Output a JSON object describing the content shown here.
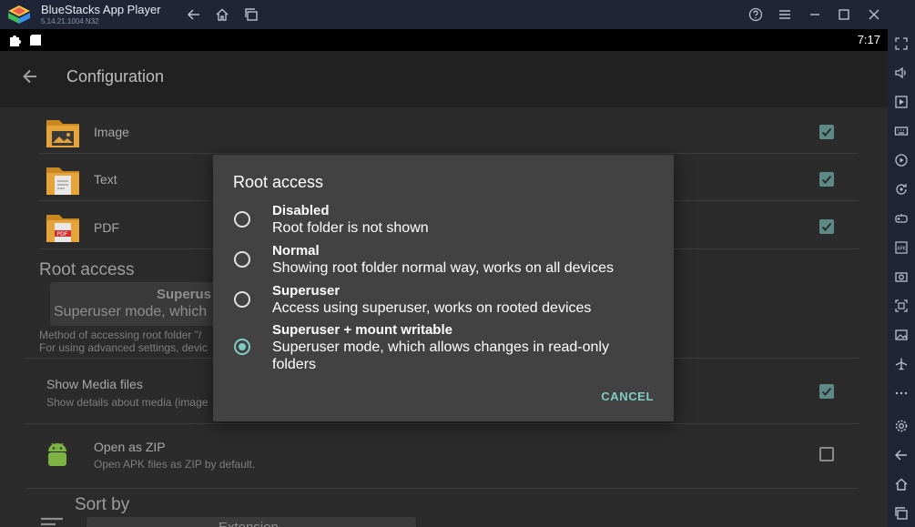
{
  "window": {
    "app_name": "BlueStacks App Player",
    "version": "5.14.21.1004  N32"
  },
  "statusbar": {
    "time": "7:17"
  },
  "appbar": {
    "title": "Configuration"
  },
  "file_types": [
    {
      "label": "Image",
      "checked": true
    },
    {
      "label": "Text",
      "checked": true
    },
    {
      "label": "PDF",
      "checked": true
    }
  ],
  "root_access_section": {
    "title": "Root access",
    "selected_title": "Superus",
    "selected_desc": "Superuser mode, which",
    "desc_line1": "Method of accessing root folder \"/",
    "desc_line2": "For using advanced settings, devic"
  },
  "show_media": {
    "label": "Show Media files",
    "sub": "Show details about media (image",
    "checked": true
  },
  "open_zip": {
    "label": "Open as ZIP",
    "sub": "Open APK files as ZIP by default.",
    "checked": false
  },
  "sort_by": {
    "title": "Sort by",
    "value": "Extension"
  },
  "dialog": {
    "title": "Root access",
    "options": [
      {
        "title": "Disabled",
        "desc": "Root folder is not shown",
        "selected": false
      },
      {
        "title": "Normal",
        "desc": "Showing root folder normal way, works on all devices",
        "selected": false
      },
      {
        "title": "Superuser",
        "desc": "Access using superuser, works on rooted devices",
        "selected": false
      },
      {
        "title": "Superuser + mount writable",
        "desc": "Superuser mode, which allows changes in read-only folders",
        "selected": true
      }
    ],
    "cancel_label": "CANCEL"
  },
  "colors": {
    "accent": "#80cbc4",
    "dialog_bg": "#424242",
    "check_bg": "#5d8a86"
  }
}
